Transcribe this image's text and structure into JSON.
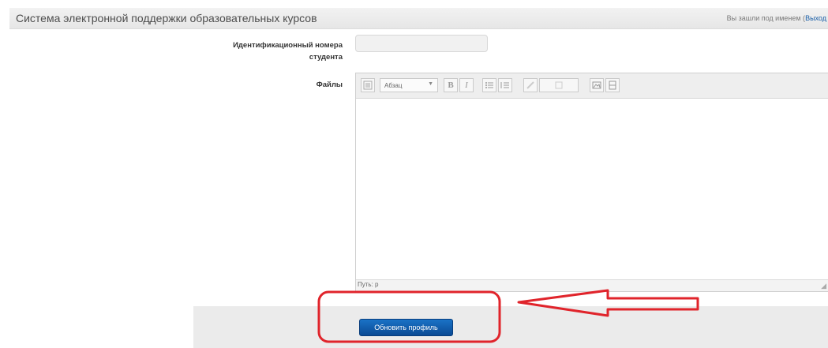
{
  "header": {
    "site_title": "Система электронной поддержки образовательных курсов",
    "login_prefix": "Вы зашли под именем (",
    "logout_link": "Выход"
  },
  "form": {
    "student_id_label_line1": "Идентификационный номера",
    "student_id_label_line2": "студента",
    "student_id_value": "",
    "files_label": "Файлы"
  },
  "editor": {
    "format_value": "Абзац",
    "toolbar_icons": [
      "toolbar-toggle-icon",
      "format-select",
      "bold-icon",
      "italic-icon",
      "bullet-list-icon",
      "numbered-list-icon",
      "link-icon",
      "unlink-icon",
      "image-icon",
      "media-icon"
    ],
    "bold_glyph": "B",
    "italic_glyph": "I",
    "path_label": "Путь: p",
    "content": ""
  },
  "actions": {
    "update_profile": "Обновить профиль"
  },
  "annotation": {
    "color": "#e0242b"
  }
}
